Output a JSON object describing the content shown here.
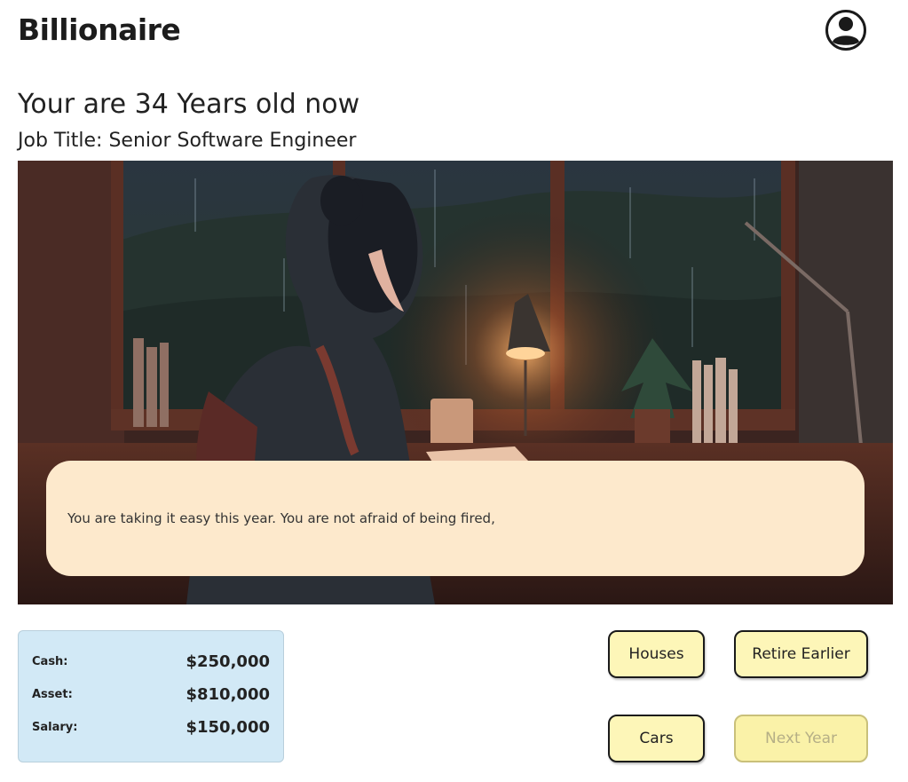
{
  "app": {
    "title": "Billionaire"
  },
  "header": {
    "profile_icon": "user-circle-icon"
  },
  "status": {
    "age_heading": "Your are 34 Years old now",
    "job_title": "Job Title: Senior Software Engineer"
  },
  "scene": {
    "image": "anime-girl-studying-rainy-window",
    "message": "You are taking it easy this year. You are not afraid of being fired,"
  },
  "stats": {
    "cash_label": "Cash:",
    "cash_value": "$250,000",
    "asset_label": "Asset:",
    "asset_value": "$810,000",
    "salary_label": "Salary:",
    "salary_value": "$150,000"
  },
  "actions": {
    "houses": "Houses",
    "retire": "Retire Earlier",
    "cars": "Cars",
    "next_year": "Next Year"
  },
  "colors": {
    "button_bg": "#fdf6b8",
    "message_bg": "#fde9cc",
    "stats_bg": "#d2e9f6"
  }
}
